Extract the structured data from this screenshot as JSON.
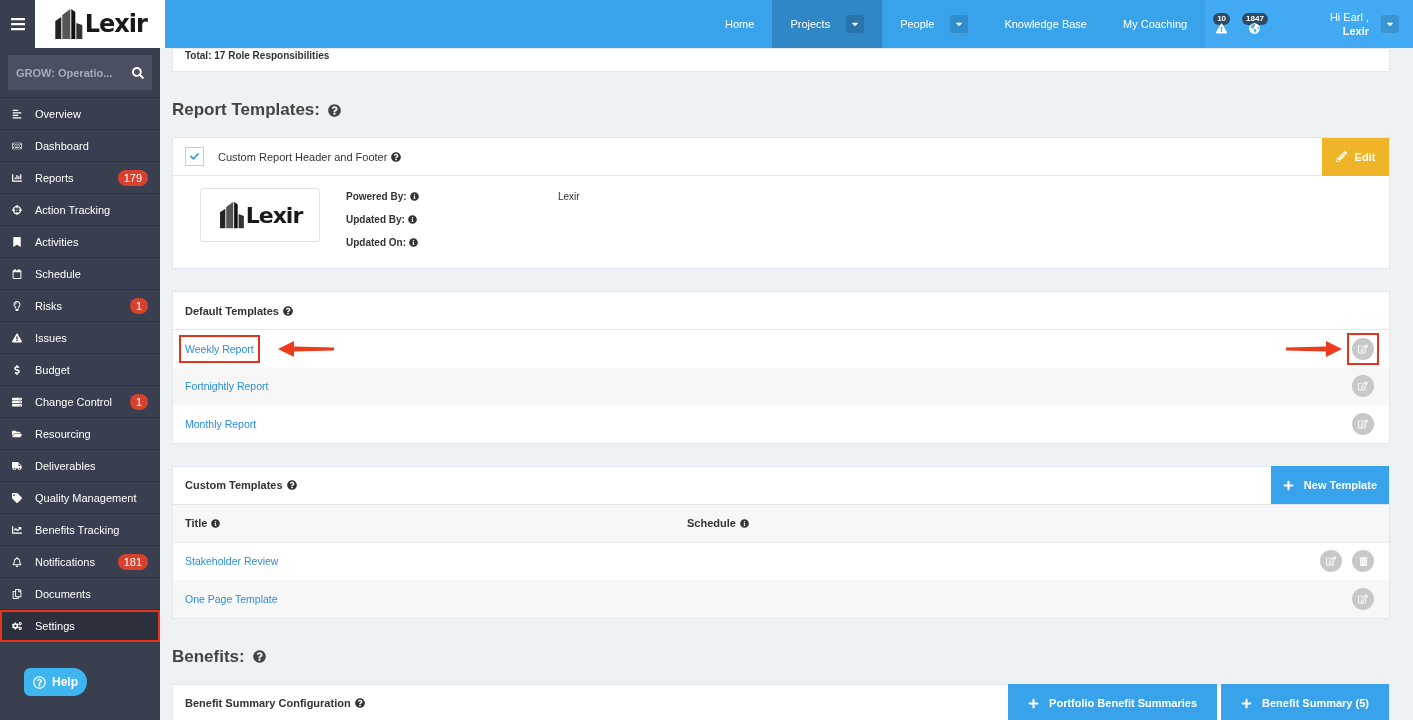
{
  "header": {
    "logo_text": "Lexir",
    "nav": [
      {
        "label": "Home",
        "selected": false,
        "dropdown": false
      },
      {
        "label": "Projects",
        "selected": true,
        "dropdown": true
      },
      {
        "label": "People",
        "selected": false,
        "dropdown": true
      },
      {
        "label": "Knowledge Base",
        "selected": false,
        "dropdown": false
      },
      {
        "label": "My Coaching",
        "selected": false,
        "dropdown": false
      }
    ],
    "alerts": [
      {
        "count": "10"
      },
      {
        "count": "1847"
      }
    ],
    "greeting": "Hi Earl ,",
    "user": "Lexir"
  },
  "sidebar": {
    "search": {
      "value": "GROW: Operatio..."
    },
    "items": [
      {
        "label": "Overview",
        "selected": false,
        "highlighted": false
      },
      {
        "label": "Dashboard",
        "selected": false,
        "highlighted": false
      },
      {
        "label": "Reports",
        "badge": "179",
        "selected": false,
        "highlighted": false
      },
      {
        "label": "Action Tracking",
        "selected": false,
        "highlighted": false
      },
      {
        "label": "Activities",
        "selected": false,
        "highlighted": false
      },
      {
        "label": "Schedule",
        "selected": false,
        "highlighted": false
      },
      {
        "label": "Risks",
        "badge": "1",
        "selected": false,
        "highlighted": false
      },
      {
        "label": "Issues",
        "selected": false,
        "highlighted": false
      },
      {
        "label": "Budget",
        "selected": false,
        "highlighted": false
      },
      {
        "label": "Change Control",
        "badge": "1",
        "selected": false,
        "highlighted": false
      },
      {
        "label": "Resourcing",
        "selected": false,
        "highlighted": false
      },
      {
        "label": "Deliverables",
        "selected": false,
        "highlighted": false
      },
      {
        "label": "Quality Management",
        "selected": false,
        "highlighted": false
      },
      {
        "label": "Benefits Tracking",
        "selected": false,
        "highlighted": false
      },
      {
        "label": "Notifications",
        "badge": "181",
        "selected": false,
        "highlighted": false
      },
      {
        "label": "Documents",
        "selected": false,
        "highlighted": false
      },
      {
        "label": "Settings",
        "selected": true,
        "highlighted": true
      }
    ],
    "help": "Help"
  },
  "main": {
    "previous_card_text": "Total: 17 Role Responsibilities",
    "report_templates": {
      "heading": "Report Templates:",
      "header_card": {
        "checked": true,
        "title": "Custom Report Header and Footer",
        "edit": "Edit",
        "logo_text": "Lexir",
        "fields": [
          {
            "label": "Powered By:",
            "value": "Lexir"
          },
          {
            "label": "Updated By:"
          },
          {
            "label": "Updated On:"
          }
        ]
      },
      "default_templates": {
        "title": "Default Templates",
        "rows": [
          {
            "name": "Weekly Report",
            "highlighted": true
          },
          {
            "name": "Fortnightly Report",
            "highlighted": false
          },
          {
            "name": "Monthly Report",
            "highlighted": false
          }
        ]
      },
      "custom_templates": {
        "title": "Custom Templates",
        "new_button": "New Template",
        "columns": [
          "Title",
          "Schedule"
        ],
        "rows": [
          {
            "name": "Stakeholder Review",
            "deletable": true
          },
          {
            "name": "One Page Template",
            "deletable": false
          }
        ]
      }
    },
    "benefits": {
      "heading": "Benefits:",
      "card_title": "Benefit Summary Configuration",
      "buttons": [
        "Portfolio Benefit Summaries",
        "Benefit Summary (5)"
      ]
    }
  }
}
